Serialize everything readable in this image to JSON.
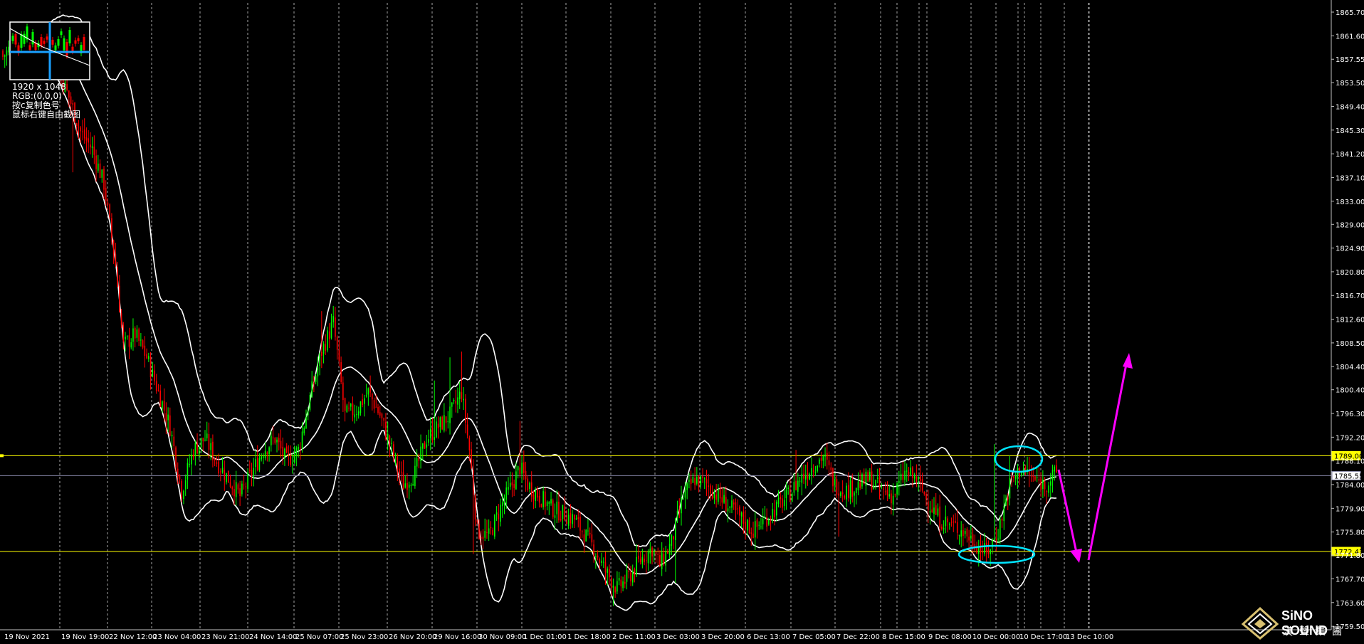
{
  "chart_data": {
    "type": "candlestick",
    "instrument_note": "",
    "y_axis": {
      "ticks": [
        "1865.70",
        "1861.60",
        "1857.55",
        "1853.50",
        "1849.40",
        "1845.30",
        "1841.20",
        "1837.10",
        "1833.00",
        "1829.00",
        "1824.90",
        "1820.80",
        "1816.70",
        "1812.60",
        "1808.50",
        "1804.40",
        "1800.40",
        "1796.30",
        "1792.20",
        "1788.10",
        "1784.00",
        "1779.90",
        "1775.80",
        "1771.80",
        "1767.70",
        "1763.60",
        "1759.50"
      ],
      "range": [
        1759.5,
        1867.0
      ]
    },
    "x_axis": {
      "labels": [
        "19 Nov 2021",
        "19 Nov 19:00",
        "22 Nov 12:00",
        "23 Nov 04:00",
        "23 Nov 21:00",
        "24 Nov 14:00",
        "25 Nov 07:00",
        "25 Nov 23:00",
        "26 Nov 20:00",
        "29 Nov 16:00",
        "30 Nov 09:00",
        "1 Dec 01:00",
        "1 Dec 18:00",
        "2 Dec 11:00",
        "3 Dec 03:00",
        "3 Dec 20:00",
        "6 Dec 13:00",
        "7 Dec 05:00",
        "7 Dec 22:00",
        "8 Dec 15:00",
        "9 Dec 08:00",
        "10 Dec 00:00",
        "10 Dec 17:00",
        "13 Dec 10:00"
      ]
    },
    "price_levels": [
      {
        "label": "1789.00",
        "value": 1789.0,
        "color": "#ffff00",
        "highlight": true
      },
      {
        "label": "1785.55",
        "value": 1785.55,
        "color": "#8080a0",
        "highlight": false
      },
      {
        "label": "1772.43",
        "value": 1772.43,
        "color": "#ffff00",
        "highlight": true
      }
    ],
    "colors": {
      "background": "#000000",
      "bull_candle": "#00ff00",
      "bear_candle": "#ff0000",
      "bollinger": "#ffffff",
      "support_resistance": "#ffff00",
      "ellipse": "#00e5ff",
      "arrow": "#ff00ff",
      "grid": "#c0c0c0"
    },
    "close_path": [
      [
        0,
        1858
      ],
      [
        10,
        1862
      ],
      [
        20,
        1860
      ],
      [
        28,
        1856
      ],
      [
        34,
        1851
      ],
      [
        40,
        1845
      ],
      [
        46,
        1842
      ],
      [
        52,
        1836
      ],
      [
        58,
        1822
      ],
      [
        62,
        1808
      ],
      [
        68,
        1810
      ],
      [
        74,
        1806
      ],
      [
        80,
        1800
      ],
      [
        86,
        1794
      ],
      [
        92,
        1783
      ],
      [
        98,
        1790
      ],
      [
        104,
        1792
      ],
      [
        110,
        1788
      ],
      [
        116,
        1785
      ],
      [
        122,
        1782
      ],
      [
        128,
        1786
      ],
      [
        134,
        1790
      ],
      [
        140,
        1792
      ],
      [
        146,
        1788
      ],
      [
        152,
        1790
      ],
      [
        158,
        1799
      ],
      [
        164,
        1807
      ],
      [
        170,
        1812
      ],
      [
        176,
        1796
      ],
      [
        182,
        1797
      ],
      [
        188,
        1800
      ],
      [
        194,
        1796
      ],
      [
        200,
        1790
      ],
      [
        206,
        1784
      ],
      [
        212,
        1786
      ],
      [
        218,
        1792
      ],
      [
        224,
        1794
      ],
      [
        230,
        1796
      ],
      [
        236,
        1800
      ],
      [
        240,
        1790
      ],
      [
        244,
        1776
      ],
      [
        250,
        1775
      ],
      [
        256,
        1780
      ],
      [
        262,
        1784
      ],
      [
        266,
        1787
      ],
      [
        270,
        1784
      ],
      [
        276,
        1782
      ],
      [
        282,
        1780
      ],
      [
        288,
        1779
      ],
      [
        294,
        1778
      ],
      [
        298,
        1776
      ],
      [
        304,
        1773
      ],
      [
        310,
        1769
      ],
      [
        316,
        1766
      ],
      [
        322,
        1768
      ],
      [
        328,
        1771
      ],
      [
        334,
        1773
      ],
      [
        338,
        1770
      ],
      [
        344,
        1774
      ],
      [
        350,
        1782
      ],
      [
        356,
        1785
      ],
      [
        362,
        1784
      ],
      [
        368,
        1782
      ],
      [
        374,
        1780
      ],
      [
        380,
        1778
      ],
      [
        386,
        1776
      ],
      [
        392,
        1778
      ],
      [
        398,
        1780
      ],
      [
        404,
        1782
      ],
      [
        410,
        1785
      ],
      [
        416,
        1787
      ],
      [
        422,
        1789
      ],
      [
        428,
        1784
      ],
      [
        434,
        1783
      ],
      [
        440,
        1784
      ],
      [
        446,
        1785
      ],
      [
        452,
        1783
      ],
      [
        458,
        1782
      ],
      [
        464,
        1786
      ],
      [
        470,
        1785
      ],
      [
        476,
        1781
      ],
      [
        482,
        1778
      ],
      [
        488,
        1777
      ],
      [
        494,
        1776
      ],
      [
        500,
        1774
      ],
      [
        506,
        1772
      ],
      [
        512,
        1776
      ],
      [
        518,
        1784
      ],
      [
        524,
        1787
      ],
      [
        530,
        1785
      ],
      [
        536,
        1784
      ],
      [
        542,
        1786
      ]
    ],
    "annotations": [
      {
        "type": "ellipse",
        "label": "resistance touch"
      },
      {
        "type": "ellipse",
        "label": "support touch"
      },
      {
        "type": "arrow",
        "direction": "down"
      },
      {
        "type": "arrow",
        "direction": "up"
      }
    ]
  },
  "crosshair_info": {
    "size": "1920 x 1048",
    "rgb": "RGB:(0,0,0)",
    "hint1": "按c复制色号",
    "hint2": "鼠标右键自由截图"
  },
  "logo": {
    "brand": "SiNO SOUND",
    "brand_cn": "漢聲集團"
  }
}
